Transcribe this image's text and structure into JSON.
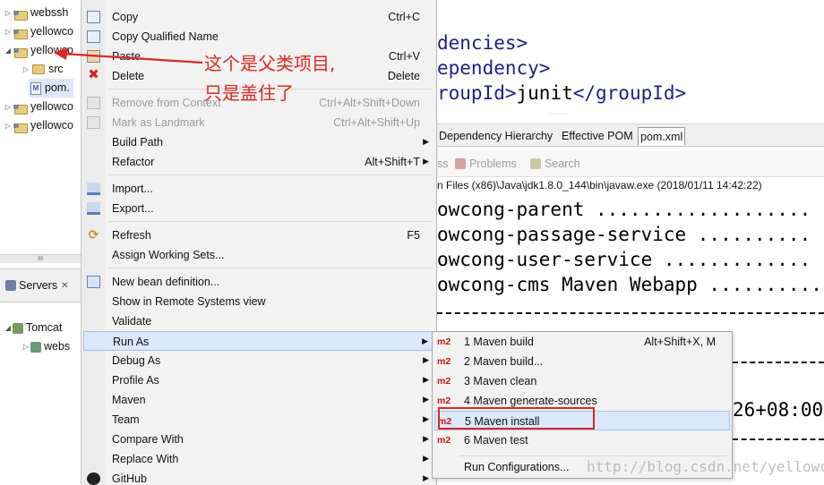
{
  "tree": {
    "items": [
      {
        "label": "webssh"
      },
      {
        "label": "yellowco"
      },
      {
        "label": "yellowco"
      },
      {
        "label": "src"
      },
      {
        "label": "pom."
      },
      {
        "label": "yellowco"
      },
      {
        "label": "yellowco"
      }
    ],
    "scroll_glyph": "III"
  },
  "servers": {
    "tab_label": "Servers",
    "close_glyph": "✕",
    "items": [
      {
        "label": "Tomcat"
      },
      {
        "label": "webs"
      }
    ]
  },
  "editor": {
    "lines": [
      {
        "tag": "dencies>",
        "text": ""
      },
      {
        "tag": "ependency>",
        "text": ""
      },
      {
        "tag": "roupId>",
        "text": "junit",
        "close": "</groupId>"
      }
    ]
  },
  "pom_tabs": [
    "Dependency Hierarchy",
    "Effective POM",
    "pom.xml"
  ],
  "console": {
    "tabs": [
      "ss",
      "Problems",
      "Search"
    ],
    "path_line": "n Files (x86)\\Java\\jdk1.8.0_144\\bin\\javaw.exe (2018/01/11 14:42:22)",
    "lines": [
      "owcong-parent ...................",
      "owcong-passage-service ..........",
      "owcong-user-service .............",
      "owcong-cms Maven Webapp ..........",
      "26+08:00"
    ]
  },
  "context_menu": {
    "items": [
      {
        "label": "Copy",
        "shortcut": "Ctrl+C"
      },
      {
        "label": "Copy Qualified Name",
        "shortcut": ""
      },
      {
        "label": "Paste",
        "shortcut": "Ctrl+V"
      },
      {
        "label": "Delete",
        "shortcut": "Delete"
      },
      {
        "label": "Remove from Context",
        "shortcut": "Ctrl+Alt+Shift+Down"
      },
      {
        "label": "Mark as Landmark",
        "shortcut": "Ctrl+Alt+Shift+Up"
      },
      {
        "label": "Build Path",
        "shortcut": ""
      },
      {
        "label": "Refactor",
        "shortcut": "Alt+Shift+T"
      },
      {
        "label": "Import...",
        "shortcut": ""
      },
      {
        "label": "Export...",
        "shortcut": ""
      },
      {
        "label": "Refresh",
        "shortcut": "F5"
      },
      {
        "label": "Assign Working Sets...",
        "shortcut": ""
      },
      {
        "label": "New bean definition...",
        "shortcut": ""
      },
      {
        "label": "Show in Remote Systems view",
        "shortcut": ""
      },
      {
        "label": "Validate",
        "shortcut": ""
      },
      {
        "label": "Run As",
        "shortcut": ""
      },
      {
        "label": "Debug As",
        "shortcut": ""
      },
      {
        "label": "Profile As",
        "shortcut": ""
      },
      {
        "label": "Maven",
        "shortcut": ""
      },
      {
        "label": "Team",
        "shortcut": ""
      },
      {
        "label": "Compare With",
        "shortcut": ""
      },
      {
        "label": "Replace With",
        "shortcut": ""
      },
      {
        "label": "GitHub",
        "shortcut": ""
      }
    ],
    "submenu_arrow": "▶"
  },
  "run_as_submenu": {
    "badge": "m2",
    "items": [
      {
        "label": "1 Maven build",
        "shortcut": "Alt+Shift+X, M"
      },
      {
        "label": "2 Maven build...",
        "shortcut": ""
      },
      {
        "label": "3 Maven clean",
        "shortcut": ""
      },
      {
        "label": "4 Maven generate-sources",
        "shortcut": ""
      },
      {
        "label": "5 Maven install",
        "shortcut": ""
      },
      {
        "label": "6 Maven test",
        "shortcut": ""
      },
      {
        "label": "Run Configurations...",
        "shortcut": ""
      }
    ]
  },
  "annotation": {
    "line1": "这个是父类项目,",
    "line2": "只是盖住了",
    "color": "#e0261f"
  },
  "watermark": "http://blog.csdn.net/yellowcong"
}
